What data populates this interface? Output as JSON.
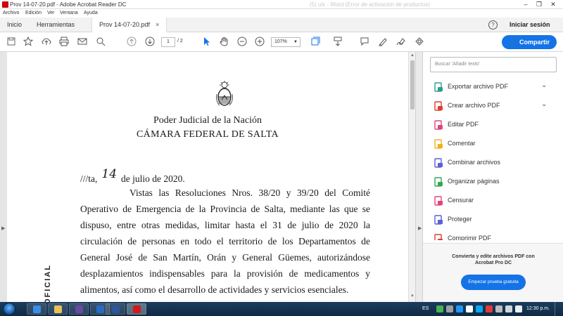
{
  "window": {
    "title": "Prov 14-07-20.pdf - Adobe Acrobat Reader DC",
    "background_title": "(5) ulx - Word (Error de activación de productos)"
  },
  "menu": [
    "Archivo",
    "Edición",
    "Ver",
    "Ventana",
    "Ayuda"
  ],
  "tabs": {
    "home": "Inicio",
    "tools": "Herramientas",
    "document": "Prov 14-07-20.pdf",
    "close_glyph": "×"
  },
  "header": {
    "help": "?",
    "signin": "Iniciar sesión"
  },
  "toolbar": {
    "page_current": "1",
    "page_total": "/ 2",
    "zoom": "107%",
    "share_label": "Compartir"
  },
  "document": {
    "heading1": "Poder Judicial de la Nación",
    "heading2": "CÁMARA FEDERAL DE SALTA",
    "dateline_prefix": "///ta,",
    "dateline_handwritten": "14",
    "dateline_suffix": "de julio de 2020.",
    "lines": [
      "Vistas las Resoluciones Nros. 38/20 y 39/20 del Comité",
      "Operativo de Emergencia de la Provincia de Salta, mediante las que se",
      "dispuso, entre otras medidas, limitar hasta el 31 de julio de 2020 la",
      "circulación de personas en todo el territorio de los Departamentos de",
      "General José de San Martín, Orán y General Güemes, autorizándose",
      "desplazamientos indispensables para la provisión de medicamentos y",
      "alimentos, así como el desarrollo de actividades y servicios esenciales."
    ],
    "stamp": "OFICIAL"
  },
  "panel": {
    "search_placeholder": "Buscar 'Añadir texto'",
    "tools": [
      {
        "label": "Exportar archivo PDF",
        "color": "#2d9b8f",
        "expandable": true
      },
      {
        "label": "Crear archivo PDF",
        "color": "#e03c31",
        "expandable": true
      },
      {
        "label": "Editar PDF",
        "color": "#e0457b",
        "expandable": false
      },
      {
        "label": "Comentar",
        "color": "#f2b01e",
        "expandable": false
      },
      {
        "label": "Combinar archivos",
        "color": "#5a5fd6",
        "expandable": false
      },
      {
        "label": "Organizar páginas",
        "color": "#33a852",
        "expandable": false
      },
      {
        "label": "Censurar",
        "color": "#e0457b",
        "expandable": false
      },
      {
        "label": "Proteger",
        "color": "#5a5fd6",
        "expandable": false
      },
      {
        "label": "Comprimir PDF",
        "color": "#e03c31",
        "expandable": false
      }
    ],
    "promo_text": "Convierta y edite archivos PDF con Acrobat Pro DC",
    "trial_button": "Empezar prueba gratuita"
  },
  "taskbar": {
    "language": "ES",
    "clock": "12:30 p.m."
  },
  "colors": {
    "accent": "#1473e6",
    "titlebar_ghost": "#c9c9c9"
  }
}
